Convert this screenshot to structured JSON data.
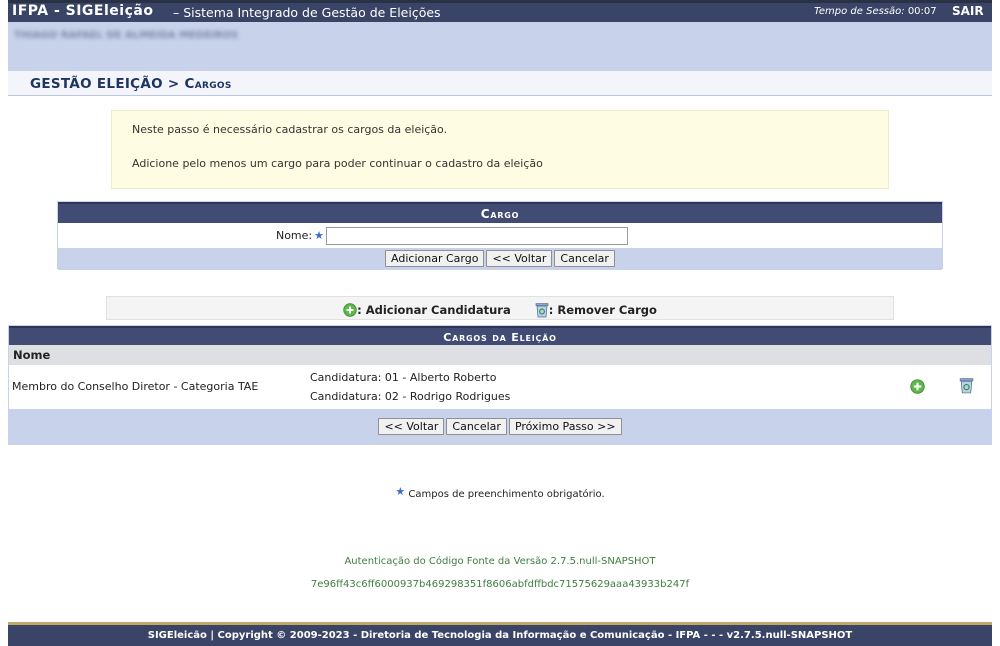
{
  "topbar": {
    "app_name": "IFPA - SIGEleição",
    "subtitle": "– Sistema Integrado de Gestão de Eleições",
    "session_label": "Tempo de Sessão:",
    "session_time": "00:07",
    "logout_label": "SAIR"
  },
  "user": {
    "name": "THIAGO RAFAEL DE ALMEIDA MEDEIROS"
  },
  "breadcrumb": {
    "section": "GESTÃO ELEIÇÃO",
    "separator": " > ",
    "page": "Cargos"
  },
  "notice": {
    "line1": "Neste passo é necessário cadastrar os cargos da eleição.",
    "line2": "Adicione pelo menos um cargo para poder continuar o cadastro da eleição"
  },
  "form": {
    "caption": "Cargo",
    "name_label": "Nome:",
    "name_value": "",
    "buttons": {
      "add": "Adicionar Cargo",
      "back": "<< Voltar",
      "cancel": "Cancelar"
    }
  },
  "legend": {
    "add_candidacy": ": Adicionar Candidatura",
    "remove_cargo": ": Remover Cargo"
  },
  "cargos": {
    "caption": "Cargos da Eleição",
    "column_name": "Nome",
    "rows": [
      {
        "name": "Membro do Conselho Diretor - Categoria TAE",
        "candidaturas": [
          "Candidatura: 01 -  Alberto Roberto",
          "Candidatura: 02 -  Rodrigo Rodrigues"
        ]
      }
    ],
    "buttons": {
      "back": "<< Voltar",
      "cancel": "Cancelar",
      "next": "Próximo Passo >>"
    }
  },
  "required_note": "Campos de preenchimento obrigatório.",
  "auth": {
    "line1": "Autenticação do Código Fonte da Versão 2.7.5.null-SNAPSHOT",
    "line2": "7e96ff43c6ff6000937b469298351f8606abfdffbdc71575629aaa43933b247f"
  },
  "footer": "SIGEleicão | Copyright © 2009-2023 - Diretoria de Tecnologia da Informação e Comunicação - IFPA - - - v2.7.5.null-SNAPSHOT",
  "colors": {
    "header": "#3a4466",
    "band": "#c8d3eb",
    "notice": "#fefde3",
    "link_green": "#3f7d3f"
  },
  "icons": {
    "add": "green-plus-icon",
    "remove": "recycle-bin-icon",
    "required": "star-icon"
  }
}
